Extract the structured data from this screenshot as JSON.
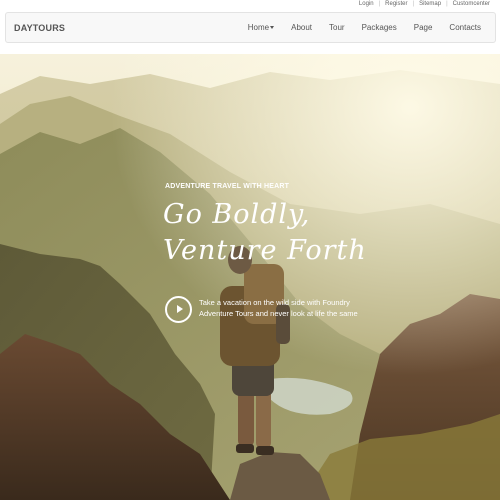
{
  "top_links": [
    "Login",
    "Register",
    "Sitemap",
    "Customcenter"
  ],
  "top_separator": "|",
  "brand": "DAYTOURS",
  "nav": {
    "items": [
      {
        "label": "Home",
        "has_dropdown": true
      },
      {
        "label": "About"
      },
      {
        "label": "Tour"
      },
      {
        "label": "Packages"
      },
      {
        "label": "Page"
      },
      {
        "label": "Contacts"
      }
    ]
  },
  "hero": {
    "tagline": "ADVENTURE TRAVEL WITH HEART",
    "headline_line1": "Go Boldly,",
    "headline_line2": "Venture Forth",
    "description": "Take a vacation on the wild side with Foundry Adventure Tours and never look at life the same",
    "image": "hiker-mountain-sunset"
  },
  "colors": {
    "nav_bg": "#f8f8f8",
    "nav_border": "#e3e3e3",
    "nav_text": "#555555",
    "hero_text": "#ffffff",
    "sky": "#f4eed6"
  }
}
